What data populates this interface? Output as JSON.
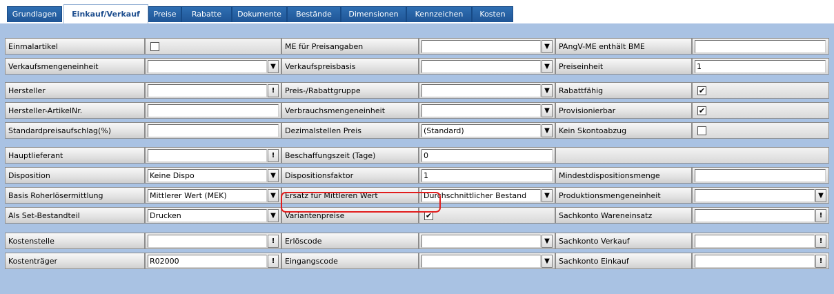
{
  "tabs": [
    "Grundlagen",
    "Einkauf/Verkauf",
    "Preise",
    "Rabatte",
    "Dokumente",
    "Bestände",
    "Dimensionen",
    "Kennzeichen",
    "Kosten"
  ],
  "active_tab": "Einkauf/Verkauf",
  "rows": {
    "einmalartikel": {
      "label": "Einmalartikel",
      "checked": false
    },
    "me_preisangaben": {
      "label": "ME für Preisangaben",
      "value": ""
    },
    "pangv": {
      "label": "PAngV-ME enthält BME",
      "value": ""
    },
    "verkaufsmengeneinheit": {
      "label": "Verkaufsmengeneinheit",
      "value": ""
    },
    "verkaufspreisbasis": {
      "label": "Verkaufspreisbasis",
      "value": ""
    },
    "preiseinheit": {
      "label": "Preiseinheit",
      "value": "1"
    },
    "hersteller": {
      "label": "Hersteller",
      "value": ""
    },
    "preis_rabattgruppe": {
      "label": "Preis-/Rabattgruppe",
      "value": ""
    },
    "rabattfaehig": {
      "label": "Rabattfähig",
      "checked": true
    },
    "hersteller_artikelnr": {
      "label": "Hersteller-ArtikelNr.",
      "value": ""
    },
    "verbrauchsmengeneinheit": {
      "label": "Verbrauchsmengeneinheit",
      "value": ""
    },
    "provisionierbar": {
      "label": "Provisionierbar",
      "checked": true
    },
    "standardpreisaufschlag": {
      "label": "Standardpreisaufschlag(%)",
      "value": ""
    },
    "dezimalstellen": {
      "label": "Dezimalstellen Preis",
      "value": "(Standard)"
    },
    "kein_skontoabzug": {
      "label": "Kein Skontoabzug",
      "checked": false
    },
    "hauptlieferant": {
      "label": "Hauptlieferant",
      "value": ""
    },
    "beschaffungszeit": {
      "label": "Beschaffungszeit (Tage)",
      "value": "0"
    },
    "disposition": {
      "label": "Disposition",
      "value": "Keine Dispo"
    },
    "dispositionsfaktor": {
      "label": "Dispositionsfaktor",
      "value": "1"
    },
    "mindestdispositionsmenge": {
      "label": "Mindestdispositionsmenge",
      "value": ""
    },
    "basis_roherloes": {
      "label": "Basis Roherlösermittlung",
      "value": "Mittlerer Wert (MEK)"
    },
    "ersatz_mittlerer": {
      "label": "Ersatz für Mittleren Wert",
      "value": "Durchschnittlicher Bestand"
    },
    "produktionsmengeneinheit": {
      "label": "Produktionsmengeneinheit",
      "value": ""
    },
    "als_set": {
      "label": "Als Set-Bestandteil",
      "value": "Drucken"
    },
    "variantenpreise": {
      "label": "Variantenpreise",
      "checked": true
    },
    "sachkonto_wareneinsatz": {
      "label": "Sachkonto Wareneinsatz",
      "value": ""
    },
    "kostenstelle": {
      "label": "Kostenstelle",
      "value": ""
    },
    "erloescode": {
      "label": "Erlöscode",
      "value": ""
    },
    "sachkonto_verkauf": {
      "label": "Sachkonto Verkauf",
      "value": ""
    },
    "kostentraeger": {
      "label": "Kostenträger",
      "value": "R02000"
    },
    "eingangscode": {
      "label": "Eingangscode",
      "value": ""
    },
    "sachkonto_einkauf": {
      "label": "Sachkonto Einkauf",
      "value": ""
    }
  },
  "glyphs": {
    "dropdown": "▼",
    "lookup": "!",
    "check": "✔"
  },
  "colors": {
    "tab_bg": "#1f5596",
    "content_bg": "#a9c2e3",
    "highlight": "#e11d1d"
  }
}
